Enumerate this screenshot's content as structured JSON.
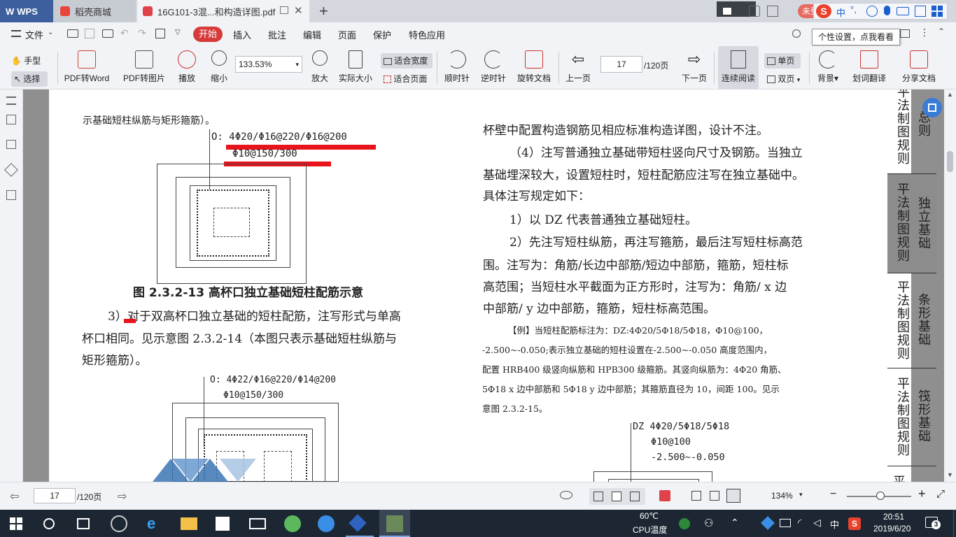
{
  "tabs": [
    {
      "label": "WPS"
    },
    {
      "label": "稻壳商城"
    },
    {
      "label": "16G101-3混...和构造详图.pdf"
    }
  ],
  "tabbar_right": {
    "unlogged": "未登",
    "ime_label": "中"
  },
  "tooltip": "个性设置，点我看看",
  "menu": {
    "file": "文件",
    "start": "开始",
    "items": [
      "插入",
      "批注",
      "编辑",
      "页面",
      "保护",
      "特色应用"
    ]
  },
  "toolbar": {
    "hand": "手型",
    "select": "选择",
    "pdf_to_word": "PDF转Word",
    "pdf_to_image": "PDF转图片",
    "play": "播放",
    "zoom_out": "缩小",
    "zoom_value": "133.53%",
    "zoom_in": "放大",
    "actual_size": "实际大小",
    "fit_width": "适合宽度",
    "fit_page": "适合页面",
    "clockwise": "顺时针",
    "counterclockwise": "逆时针",
    "rotate_doc": "旋转文档",
    "prev_page": "上一页",
    "page_input": "17",
    "page_total": "/120页",
    "next_page": "下一页",
    "continuous": "连续阅读",
    "single_page": "单页",
    "double_page": "双页",
    "background": "背景",
    "translate": "划词翻译",
    "share": "分享文档"
  },
  "doc": {
    "left_top": "示基础短柱纵筋与矩形箍筋）。",
    "fig1_line1": "O: 4Φ20/Φ16@220/Φ16@200",
    "fig1_line2": "Φ10@150/300",
    "fig1_caption": "图 2.3.2-13 高杯口独立基础短柱配筋示意",
    "para3_line1": "3）对于双高杯口独立基础的短柱配筋，注写形式与单高",
    "para3_line2": "杯口相同。见示意图 2.3.2-14（本图只表示基础短柱纵筋与",
    "para3_line3": "矩形箍筋）。",
    "fig2_line1": "O: 4Φ22/Φ16@220/Φ14@200",
    "fig2_line2": "Φ10@150/300",
    "right_lines": [
      "杯壁中配置构造钢筋见相应标准构造详图，设计不注。",
      "（4）注写普通独立基础带短柱竖向尺寸及钢筋。当独立",
      "基础埋深较大，设置短柱时，短柱配筋应注写在独立基础中。",
      "具体注写规定如下：",
      "1）以 DZ 代表普通独立基础短柱。",
      "2）先注写短柱纵筋，再注写箍筋，最后注写短柱标高范",
      "围。注写为：角筋/长边中部筋/短边中部筋，箍筋，短柱标",
      "高范围；当短柱水平截面为正方形时，注写为：角筋/ x 边",
      "中部筋/ y 边中部筋，箍筋，短柱标高范围。"
    ],
    "example_lines": [
      "【例】当短柱配筋标注为：DZ:4Φ20/5Φ18/5Φ18，Φ10@100，",
      "-2.500~-0.050;表示独立基础的短柱设置在-2.500~-0.050 高度范围内，",
      "配置 HRB400 级竖向纵筋和 HPB300 级箍筋。其竖向纵筋为：4Φ20 角筋、",
      "5Φ18 x 边中部筋和 5Φ18 y 边中部筋；其箍筋直径为 10，间距 100。见示",
      "意图 2.3.2-15。"
    ],
    "fig3_line1": "DZ 4Φ20/5Φ18/5Φ18",
    "fig3_line2": "Φ10@100",
    "fig3_line3": "-2.500~-0.050"
  },
  "side_tabs": [
    {
      "left": "平法制图规则",
      "right": "总则"
    },
    {
      "left": "平法制图规则",
      "right": "独立基础"
    },
    {
      "left": "平法制图规则",
      "right": "条形基础"
    },
    {
      "left": "平法制图规则",
      "right": "筏形基础"
    },
    {
      "left": "平",
      "right": ""
    }
  ],
  "status": {
    "page_input": "17",
    "page_total": "/120页",
    "zoom": "134%"
  },
  "taskbar": {
    "temp": "60℃",
    "cpu_label": "CPU温度",
    "ime": "中",
    "time": "20:51",
    "date": "2019/6/20",
    "notify_count": "3"
  },
  "colors": {
    "accent_red": "#d63a3a",
    "wps_blue": "#3d5f9e",
    "highlight_red": "#e8141c"
  }
}
